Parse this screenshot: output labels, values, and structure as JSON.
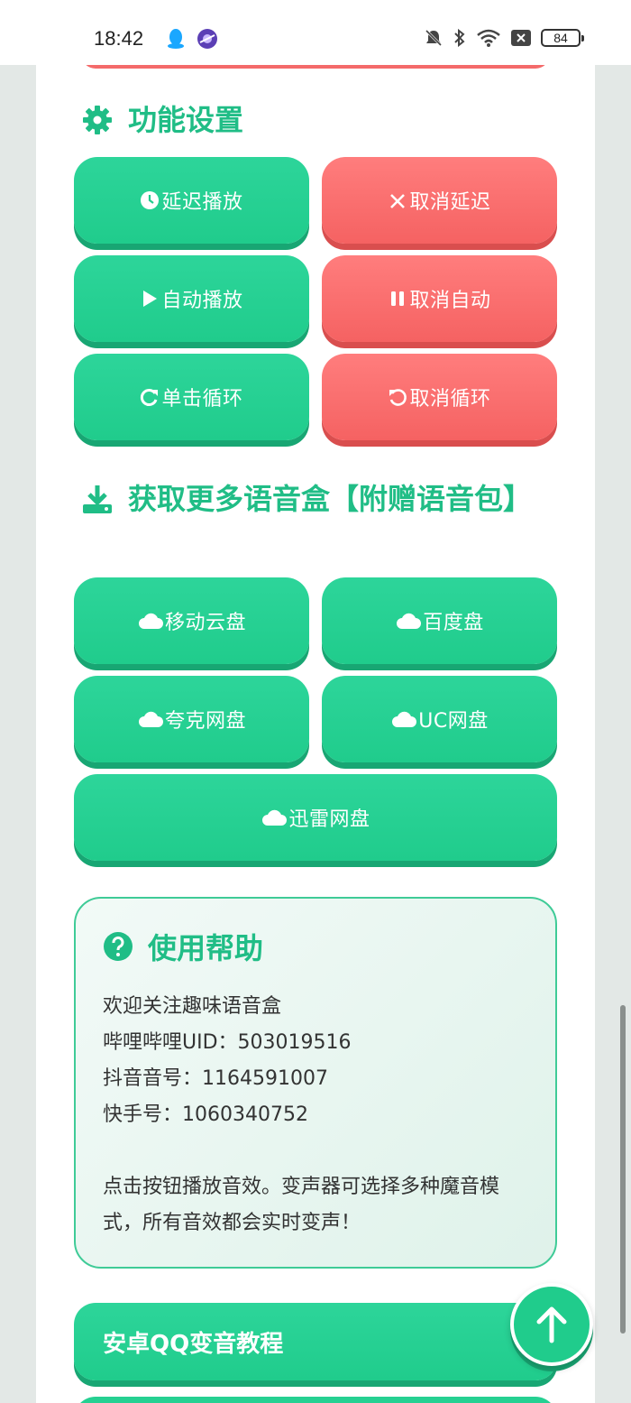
{
  "status_bar": {
    "time": "18:42",
    "battery": "84",
    "icons": [
      "qq-icon",
      "app-icon",
      "mute-icon",
      "bluetooth-icon",
      "wifi-icon",
      "close-box-icon",
      "battery-icon"
    ]
  },
  "function_settings": {
    "title": "功能设置",
    "buttons": [
      {
        "label": "延迟播放",
        "icon": "clock-icon",
        "color": "#20cc8c"
      },
      {
        "label": "取消延迟",
        "icon": "x-icon",
        "color": "#f56262"
      },
      {
        "label": "自动播放",
        "icon": "play-icon",
        "color": "#20cc8c"
      },
      {
        "label": "取消自动",
        "icon": "pause-icon",
        "color": "#f56262"
      },
      {
        "label": "单击循环",
        "icon": "redo-icon",
        "color": "#20cc8c"
      },
      {
        "label": "取消循环",
        "icon": "undo-icon",
        "color": "#f56262"
      }
    ]
  },
  "get_more": {
    "title": "获取更多语音盒【附赠语音包】",
    "buttons": [
      {
        "label": "移动云盘",
        "icon": "cloud-icon"
      },
      {
        "label": "百度盘",
        "icon": "cloud-icon"
      },
      {
        "label": "夸克网盘",
        "icon": "cloud-icon"
      },
      {
        "label": "UC网盘",
        "icon": "cloud-icon"
      },
      {
        "label": "迅雷网盘",
        "icon": "cloud-icon"
      }
    ]
  },
  "help": {
    "title": "使用帮助",
    "lines": [
      "欢迎关注趣味语音盒",
      "哔哩哔哩UID：503019516",
      "抖音音号：1164591007",
      "快手号：1060340752"
    ],
    "paragraph": "点击按钮播放音效。变声器可选择多种魔音模式，所有音效都会实时变声！"
  },
  "tutorial_button": {
    "label": "安卓QQ变音教程"
  },
  "colors": {
    "accent": "#20bd86",
    "green": "#20cc8c",
    "red": "#f56262"
  }
}
